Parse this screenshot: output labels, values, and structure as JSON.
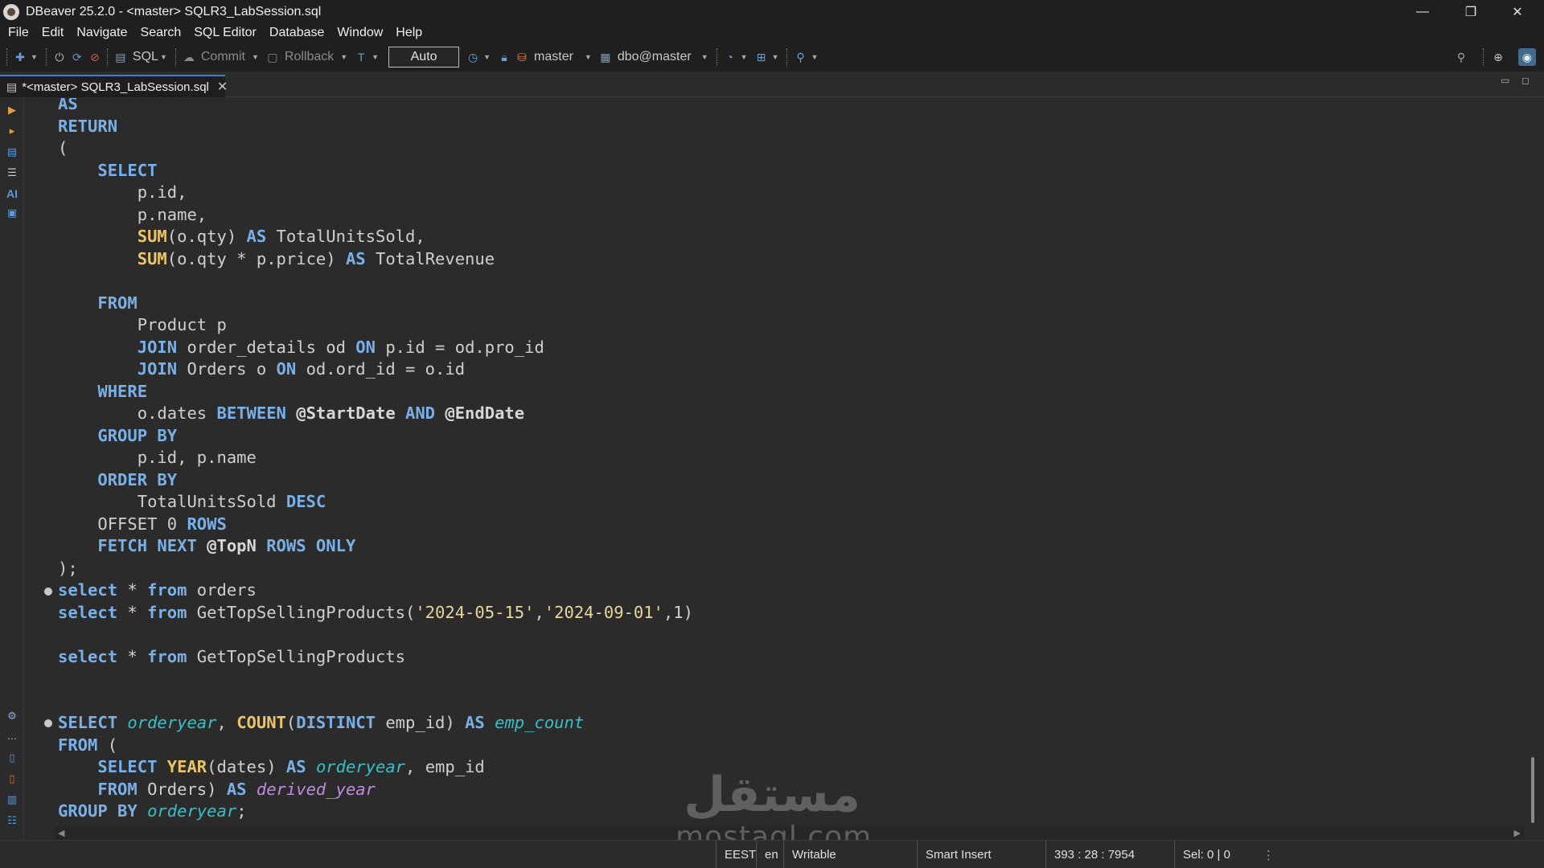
{
  "window": {
    "title": "DBeaver 25.2.0 - <master> SQLR3_LabSession.sql",
    "minimize": "—",
    "restore": "❐",
    "close": "✕"
  },
  "menu": [
    "File",
    "Edit",
    "Navigate",
    "Search",
    "SQL Editor",
    "Database",
    "Window",
    "Help"
  ],
  "toolbar": {
    "sql_label": "SQL",
    "commit_label": "Commit",
    "rollback_label": "Rollback",
    "transaction_mode": "Auto",
    "datasource": "master",
    "schema": "dbo@master"
  },
  "editor_tab": {
    "title": "*<master> SQLR3_LabSession.sql",
    "close": "✕"
  },
  "ruler": {
    "ai_label": "AI"
  },
  "code_lines": [
    [
      [
        "kw",
        "AS"
      ]
    ],
    [
      [
        "kw",
        "RETURN"
      ]
    ],
    [
      [
        "id",
        "("
      ]
    ],
    [
      [
        "id",
        "    "
      ],
      [
        "kw",
        "SELECT"
      ]
    ],
    [
      [
        "id",
        "        p.id,"
      ]
    ],
    [
      [
        "id",
        "        p.name,"
      ]
    ],
    [
      [
        "id",
        "        "
      ],
      [
        "fn",
        "SUM"
      ],
      [
        "id",
        "(o.qty) "
      ],
      [
        "kw",
        "AS"
      ],
      [
        "id",
        " TotalUnitsSold,"
      ]
    ],
    [
      [
        "id",
        "        "
      ],
      [
        "fn",
        "SUM"
      ],
      [
        "id",
        "(o.qty * p.price) "
      ],
      [
        "kw",
        "AS"
      ],
      [
        "id",
        " TotalRevenue"
      ]
    ],
    [],
    [
      [
        "id",
        "    "
      ],
      [
        "kw",
        "FROM"
      ]
    ],
    [
      [
        "id",
        "        Product p"
      ]
    ],
    [
      [
        "id",
        "        "
      ],
      [
        "kw",
        "JOIN"
      ],
      [
        "id",
        " order_details od "
      ],
      [
        "kw",
        "ON"
      ],
      [
        "id",
        " p.id = od.pro_id"
      ]
    ],
    [
      [
        "id",
        "        "
      ],
      [
        "kw",
        "JOIN"
      ],
      [
        "id",
        " Orders o "
      ],
      [
        "kw",
        "ON"
      ],
      [
        "id",
        " od.ord_id = o.id"
      ]
    ],
    [
      [
        "id",
        "    "
      ],
      [
        "kw",
        "WHERE"
      ]
    ],
    [
      [
        "id",
        "        o.dates "
      ],
      [
        "kw",
        "BETWEEN"
      ],
      [
        "id",
        " "
      ],
      [
        "var",
        "@StartDate"
      ],
      [
        "id",
        " "
      ],
      [
        "kw",
        "AND"
      ],
      [
        "id",
        " "
      ],
      [
        "var",
        "@EndDate"
      ]
    ],
    [
      [
        "id",
        "    "
      ],
      [
        "kw",
        "GROUP BY"
      ]
    ],
    [
      [
        "id",
        "        p.id, p.name"
      ]
    ],
    [
      [
        "id",
        "    "
      ],
      [
        "kw",
        "ORDER BY"
      ]
    ],
    [
      [
        "id",
        "        TotalUnitsSold "
      ],
      [
        "kw",
        "DESC"
      ]
    ],
    [
      [
        "id",
        "    OFFSET "
      ],
      [
        "num",
        "0"
      ],
      [
        "id",
        " "
      ],
      [
        "kw",
        "ROWS"
      ]
    ],
    [
      [
        "id",
        "    "
      ],
      [
        "kw",
        "FETCH NEXT"
      ],
      [
        "id",
        " "
      ],
      [
        "var",
        "@TopN"
      ],
      [
        "id",
        " "
      ],
      [
        "kw",
        "ROWS ONLY"
      ]
    ],
    [
      [
        "id",
        ");"
      ]
    ],
    [
      [
        "kw",
        "select"
      ],
      [
        "id",
        " * "
      ],
      [
        "kw",
        "from"
      ],
      [
        "id",
        " orders"
      ]
    ],
    [
      [
        "kw",
        "select"
      ],
      [
        "id",
        " * "
      ],
      [
        "kw",
        "from"
      ],
      [
        "id",
        " GetTopSellingProducts("
      ],
      [
        "str",
        "'2024-05-15'"
      ],
      [
        "id",
        ","
      ],
      [
        "str",
        "'2024-09-01'"
      ],
      [
        "id",
        ",1)"
      ]
    ],
    [],
    [
      [
        "kw",
        "select"
      ],
      [
        "id",
        " * "
      ],
      [
        "kw",
        "from"
      ],
      [
        "id",
        " GetTopSellingProducts"
      ]
    ],
    [],
    [],
    [
      [
        "kw",
        "SELECT"
      ],
      [
        "id",
        " "
      ],
      [
        "alias",
        "orderyear"
      ],
      [
        "id",
        ", "
      ],
      [
        "fn",
        "COUNT"
      ],
      [
        "id",
        "("
      ],
      [
        "kw",
        "DISTINCT"
      ],
      [
        "id",
        " emp_id) "
      ],
      [
        "kw",
        "AS"
      ],
      [
        "id",
        " "
      ],
      [
        "alias",
        "emp_count"
      ]
    ],
    [
      [
        "kw",
        "FROM"
      ],
      [
        "id",
        " ("
      ]
    ],
    [
      [
        "id",
        "    "
      ],
      [
        "kw",
        "SELECT"
      ],
      [
        "id",
        " "
      ],
      [
        "fn",
        "YEAR"
      ],
      [
        "id",
        "(dates) "
      ],
      [
        "kw",
        "AS"
      ],
      [
        "id",
        " "
      ],
      [
        "alias",
        "orderyear"
      ],
      [
        "id",
        ", emp_id"
      ]
    ],
    [
      [
        "id",
        "    "
      ],
      [
        "kw",
        "FROM"
      ],
      [
        "id",
        " Orders) "
      ],
      [
        "kw",
        "AS"
      ],
      [
        "id",
        " "
      ],
      [
        "alias2",
        "derived_year"
      ]
    ],
    [
      [
        "kw",
        "GROUP BY"
      ],
      [
        "id",
        " "
      ],
      [
        "alias",
        "orderyear"
      ],
      [
        "id",
        ";"
      ]
    ]
  ],
  "status": {
    "timezone": "EEST",
    "locale": "en",
    "mode": "Writable",
    "insert_mode": "Smart Insert",
    "position": "393 : 28 : 7954",
    "selection": "Sel: 0 | 0"
  },
  "watermark": {
    "logo": "مستقل",
    "url": "mostaql.com"
  },
  "colors": {
    "keyword": "#79b0e8",
    "function": "#e8c46a",
    "string": "#e6d79c",
    "alias": "#37c0c8",
    "alias_purple": "#c08be0",
    "editor_bg": "#2b2b2b",
    "chrome_bg": "#1f1f1f"
  }
}
